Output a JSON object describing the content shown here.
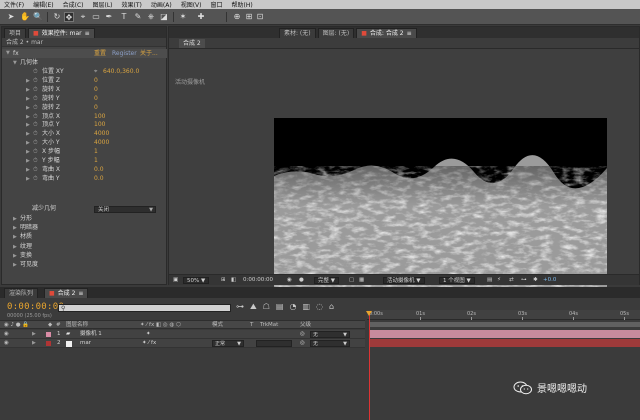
{
  "menubar": [
    "文件(F)",
    "编辑(E)",
    "合成(C)",
    "图层(L)",
    "效果(T)",
    "动画(A)",
    "视图(V)",
    "窗口",
    "帮助(H)"
  ],
  "effects_panel": {
    "tabs": [
      "项目",
      "效果控件: mar",
      "合成 2",
      "素材: (无)",
      "图层: (无)"
    ],
    "subheader": "合成 2 • mar",
    "fx_header": {
      "name": "fx",
      "reset": "重置",
      "register": "Register",
      "about": "关于..."
    },
    "group": "几何体",
    "properties": [
      {
        "name": "位置 XY",
        "value": "640.0,360.0",
        "depth": 2
      },
      {
        "name": "位置 Z",
        "value": "0",
        "depth": 2
      },
      {
        "name": "旋转 X",
        "value": "0",
        "depth": 2
      },
      {
        "name": "旋转 Y",
        "value": "0",
        "depth": 2
      },
      {
        "name": "旋转 Z",
        "value": "0",
        "depth": 2
      },
      {
        "name": "顶点 X",
        "value": "100",
        "depth": 2
      },
      {
        "name": "顶点 Y",
        "value": "100",
        "depth": 2
      },
      {
        "name": "大小 X",
        "value": "4000",
        "depth": 2
      },
      {
        "name": "大小 Y",
        "value": "4000",
        "depth": 2
      },
      {
        "name": "X 步幅",
        "value": "1",
        "depth": 2
      },
      {
        "name": "Y 步幅",
        "value": "1",
        "depth": 2
      },
      {
        "name": "弯曲 X",
        "value": "0.0",
        "depth": 2
      },
      {
        "name": "弯曲 Y",
        "value": "0.0",
        "depth": 2
      }
    ],
    "reduce_label": "减少几何",
    "reduce_value": "关闭",
    "sections": [
      "分形",
      "明暗器",
      "材质",
      "纹理",
      "变换",
      "可见度"
    ]
  },
  "comp_panel": {
    "tabs": [
      "合成: 合成 2"
    ],
    "sub_tab": "合成 2",
    "camera_label": "活动摄像机",
    "zoom": "50%",
    "timecode": "0:00:00:00",
    "resolution": "完整",
    "view": "活动摄像机",
    "views": "1 个视图",
    "exposure": "+0.0"
  },
  "timeline": {
    "tabs": [
      "渲染队列",
      "合成 2"
    ],
    "timecode": "0:00:00:00",
    "fps": "00000 (25.00 fps)",
    "headers": {
      "index": "#",
      "layer_name": "图层名称",
      "mode": "模式",
      "t": "T",
      "trkmat": "TrkMat",
      "parent": "父级"
    },
    "ruler_labels": [
      "0:00s",
      "01s",
      "02s",
      "03s",
      "04s",
      "05s"
    ],
    "layers": [
      {
        "index": "1",
        "name": "摄像机 1",
        "color": "#d98ca6",
        "mode": "",
        "parent": "无"
      },
      {
        "index": "2",
        "name": "mar",
        "color": "#b03434",
        "mode": "正常",
        "parent": "无"
      }
    ]
  },
  "watermark": "景嗯嗯嗯动"
}
